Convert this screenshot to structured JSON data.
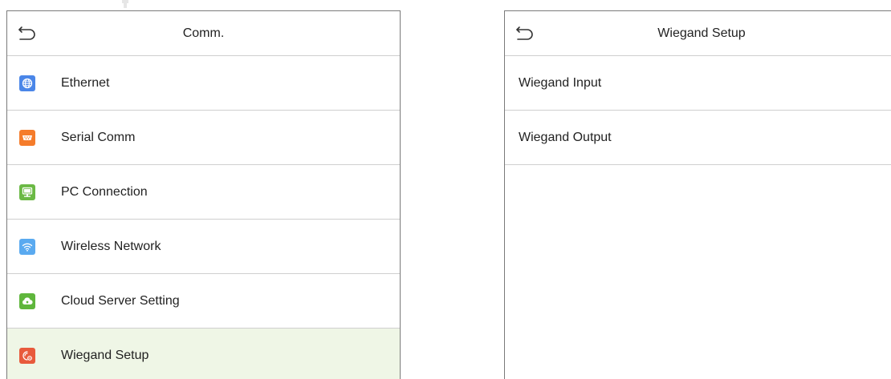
{
  "left_screen": {
    "title": "Comm.",
    "items": [
      {
        "label": "Ethernet",
        "icon": "globe-icon",
        "color": "#4a86e8"
      },
      {
        "label": "Serial Comm",
        "icon": "serial-port-icon",
        "color": "#f57c2b"
      },
      {
        "label": "PC Connection",
        "icon": "monitor-icon",
        "color": "#6bb945"
      },
      {
        "label": "Wireless Network",
        "icon": "wifi-icon",
        "color": "#5aaaf0"
      },
      {
        "label": "Cloud Server Setting",
        "icon": "cloud-icon",
        "color": "#5fb63c"
      },
      {
        "label": "Wiegand Setup",
        "icon": "wiegand-icon",
        "color": "#e85a3c",
        "selected": true
      }
    ]
  },
  "right_screen": {
    "title": "Wiegand Setup",
    "items": [
      {
        "label": "Wiegand Input"
      },
      {
        "label": "Wiegand Output"
      }
    ]
  },
  "colors": {
    "selected_row": "#eff6e6",
    "divider": "#cfcfcf",
    "frame": "#7a7a7a"
  }
}
